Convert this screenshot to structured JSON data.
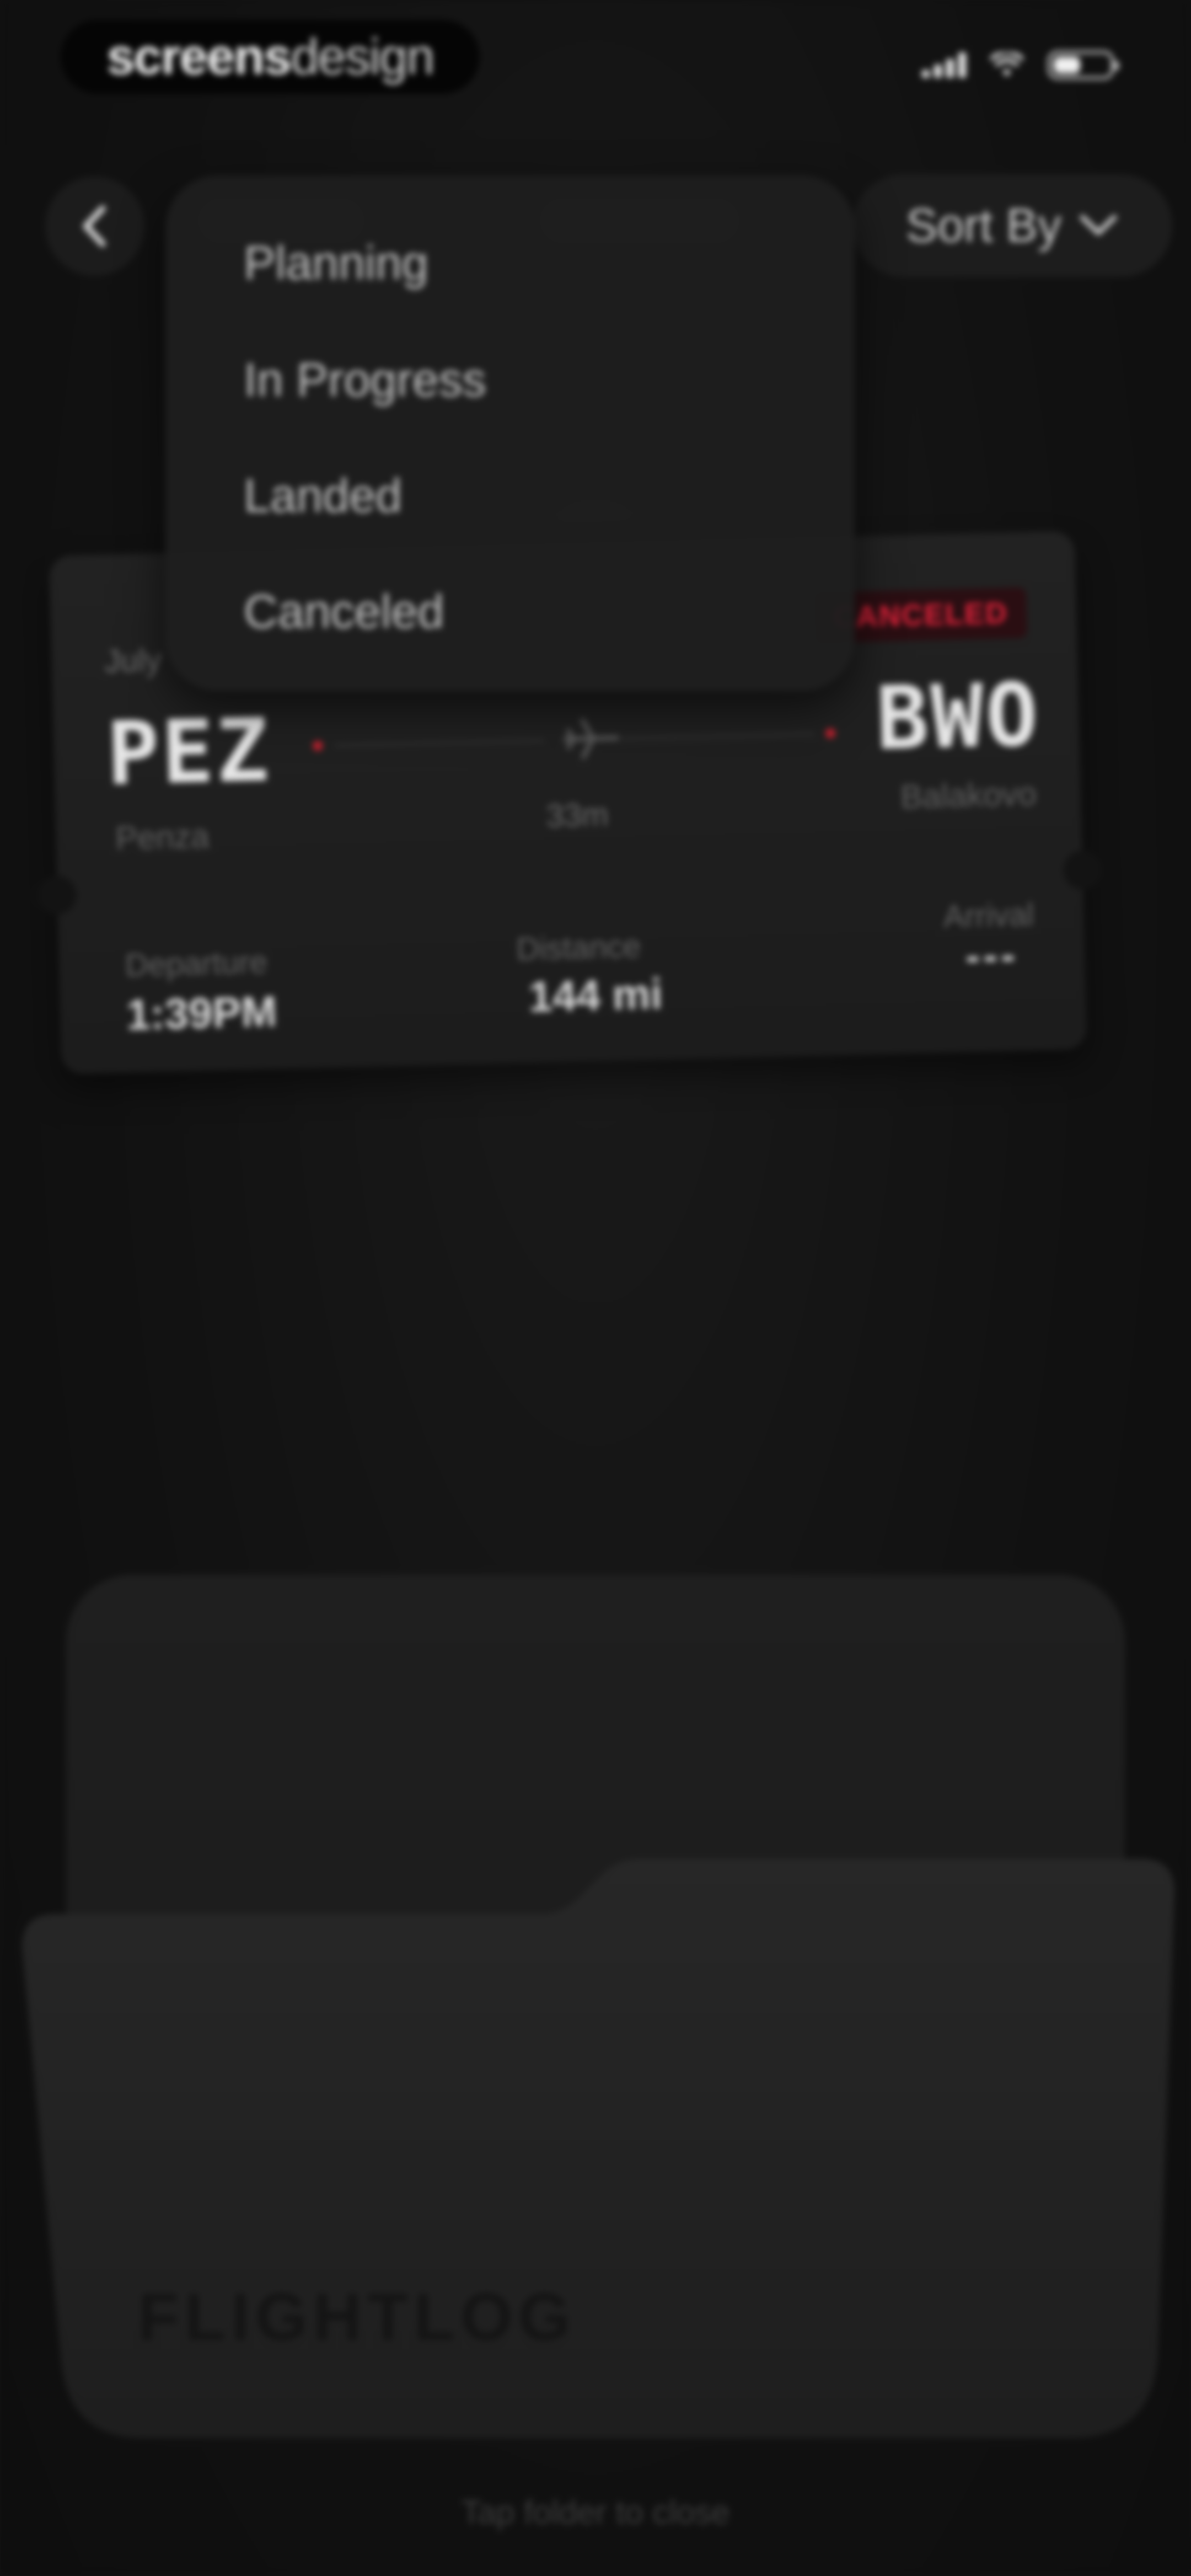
{
  "status_bar": {
    "brand_strong": "screens",
    "brand_light": "design"
  },
  "header": {
    "sort_label": "Sort By",
    "back_icon": "chevron-left-icon",
    "sort_icon": "chevron-down-icon"
  },
  "sort_menu": {
    "items": [
      "Planning",
      "In Progress",
      "Landed",
      "Canceled"
    ]
  },
  "ticket": {
    "month": "July",
    "status": "CANCELED",
    "status_color": "#e0223a",
    "from_code": "PEZ",
    "from_city": "Penza",
    "to_code": "BWO",
    "to_city": "Balakovo",
    "duration": "33m",
    "departure_label": "Departure",
    "departure_value": "1:39PM",
    "distance_label": "Distance",
    "distance_value": "144 mi",
    "arrival_label": "Arrival",
    "arrival_value": "---",
    "plane_icon": "airplane-icon"
  },
  "folder": {
    "label": "FLIGHTLOG",
    "hint": "Tap folder to close"
  }
}
